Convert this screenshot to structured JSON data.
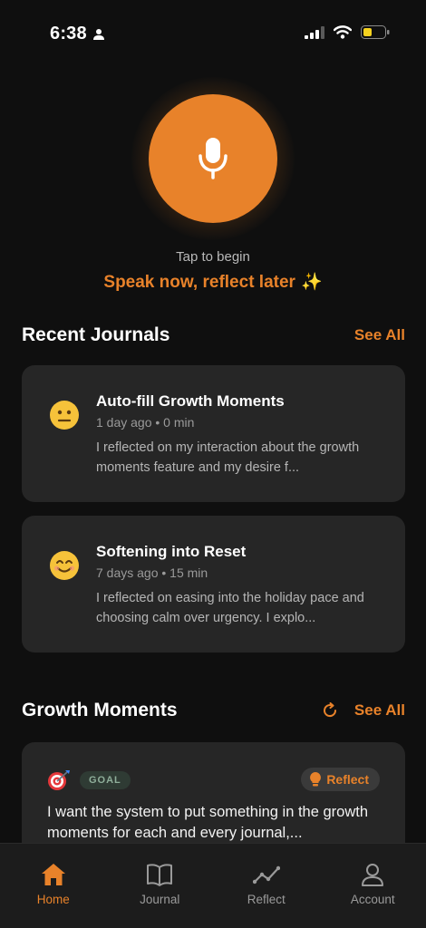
{
  "status": {
    "time": "6:38"
  },
  "recorder": {
    "hint": "Tap to begin",
    "tagline": "Speak now, reflect later",
    "sparkle": "✨"
  },
  "recent": {
    "title": "Recent Journals",
    "see_all": "See All",
    "items": [
      {
        "title": "Auto-fill Growth Moments",
        "meta": "1 day ago • 0 min",
        "mood": "neutral-face",
        "excerpt": "I reflected on my interaction about the growth moments feature and my desire f..."
      },
      {
        "title": "Softening into Reset",
        "meta": "7 days ago • 15 min",
        "mood": "smiling-face",
        "excerpt": "I reflected on easing into the holiday pace and choosing calm over urgency. I explo..."
      }
    ]
  },
  "growth": {
    "title": "Growth Moments",
    "see_all": "See All",
    "card": {
      "badge": "GOAL",
      "action": "Reflect",
      "text": "I want the system to put something in the growth moments for each and every journal,..."
    }
  },
  "tabs": [
    {
      "label": "Home",
      "icon": "home-icon",
      "active": true
    },
    {
      "label": "Journal",
      "icon": "book-icon",
      "active": false
    },
    {
      "label": "Reflect",
      "icon": "trend-icon",
      "active": false
    },
    {
      "label": "Account",
      "icon": "person-icon",
      "active": false
    }
  ],
  "colors": {
    "accent": "#e8822a",
    "card": "#262626",
    "background": "#0f0f0f"
  }
}
